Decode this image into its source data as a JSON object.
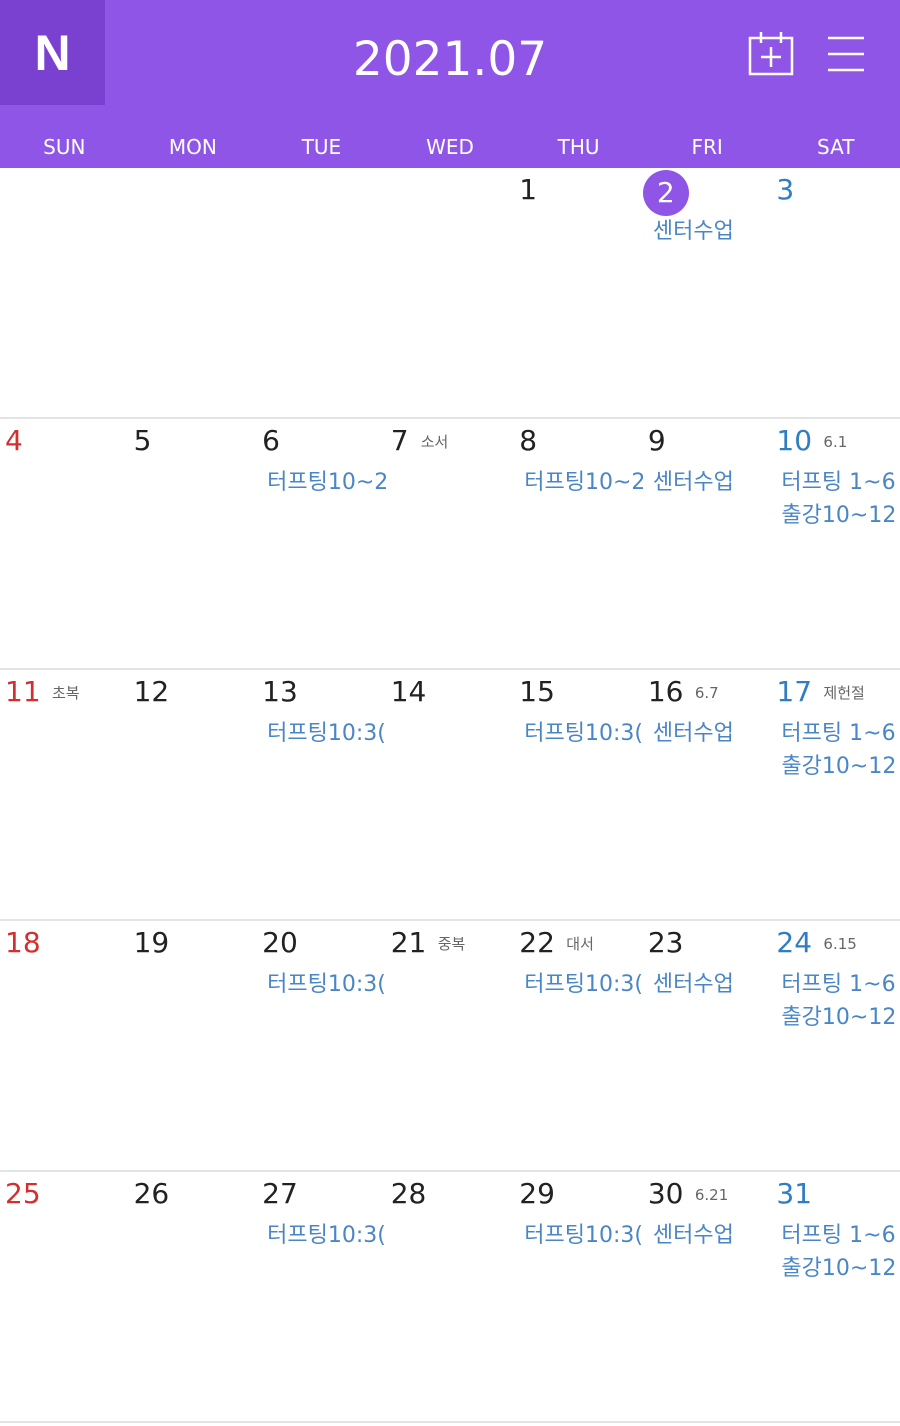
{
  "header": {
    "logo": "N",
    "title": "2021.07",
    "add_icon": "add-event-icon",
    "menu_icon": "hamburger-menu-icon",
    "bg_color": "#8f55e6",
    "logo_bg_color": "#7a41d1"
  },
  "weekdays": [
    "SUN",
    "MON",
    "TUE",
    "WED",
    "THU",
    "FRI",
    "SAT"
  ],
  "colors": {
    "sunday": "#d32f2f",
    "saturday": "#2f7dc2",
    "event": "#4a86c5",
    "today": "#8f55e6"
  },
  "weeks": [
    {
      "days": [
        {
          "day": ""
        },
        {
          "day": ""
        },
        {
          "day": ""
        },
        {
          "day": ""
        },
        {
          "day": "1"
        },
        {
          "day": "2",
          "today": true,
          "events": [
            "센터수업"
          ]
        },
        {
          "day": "3"
        }
      ]
    },
    {
      "days": [
        {
          "day": "4"
        },
        {
          "day": "5"
        },
        {
          "day": "6",
          "events": [
            "터프팅10~2"
          ]
        },
        {
          "day": "7",
          "lunar": "소서"
        },
        {
          "day": "8",
          "events": [
            "터프팅10~2"
          ]
        },
        {
          "day": "9",
          "events": [
            "센터수업"
          ]
        },
        {
          "day": "10",
          "lunar": "6.1",
          "events": [
            "터프팅 1~6",
            "출강10~12"
          ]
        }
      ]
    },
    {
      "days": [
        {
          "day": "11",
          "lunar": "초복"
        },
        {
          "day": "12"
        },
        {
          "day": "13",
          "events": [
            "터프팅10:3("
          ]
        },
        {
          "day": "14"
        },
        {
          "day": "15",
          "events": [
            "터프팅10:3("
          ]
        },
        {
          "day": "16",
          "lunar": "6.7",
          "events": [
            "센터수업"
          ]
        },
        {
          "day": "17",
          "lunar": "제헌절",
          "events": [
            "터프팅 1~6",
            "출강10~12"
          ]
        }
      ]
    },
    {
      "days": [
        {
          "day": "18"
        },
        {
          "day": "19"
        },
        {
          "day": "20",
          "events": [
            "터프팅10:3("
          ]
        },
        {
          "day": "21",
          "lunar": "중복"
        },
        {
          "day": "22",
          "lunar": "대서",
          "events": [
            "터프팅10:3("
          ]
        },
        {
          "day": "23",
          "events": [
            "센터수업"
          ]
        },
        {
          "day": "24",
          "lunar": "6.15",
          "events": [
            "터프팅 1~6",
            "출강10~12"
          ]
        }
      ]
    },
    {
      "days": [
        {
          "day": "25"
        },
        {
          "day": "26"
        },
        {
          "day": "27",
          "events": [
            "터프팅10:3("
          ]
        },
        {
          "day": "28"
        },
        {
          "day": "29",
          "events": [
            "터프팅10:3("
          ]
        },
        {
          "day": "30",
          "lunar": "6.21",
          "events": [
            "센터수업"
          ]
        },
        {
          "day": "31",
          "events": [
            "터프팅 1~6",
            "출강10~12"
          ]
        }
      ]
    }
  ]
}
